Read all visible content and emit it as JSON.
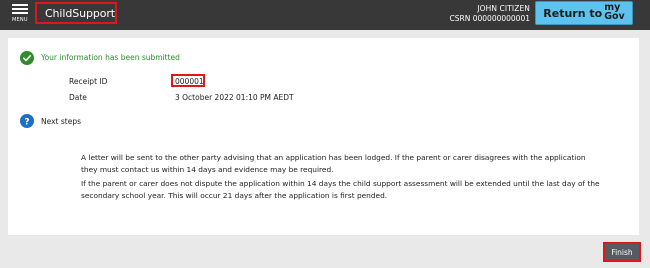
{
  "header": {
    "menu_label": "MENU",
    "brand": "ChildSupport",
    "user_name": "JOHN CITIZEN",
    "user_crn": "CSRN 000000000001",
    "return_label": "Return to",
    "mygov_my": "my",
    "mygov_gov": "Gov"
  },
  "confirmation": {
    "message": "Your information has been submitted",
    "receipt_label": "Receipt ID",
    "receipt_value": "000001",
    "date_label": "Date",
    "date_value": "3 October 2022 01:10 PM AEDT"
  },
  "next_steps": {
    "title": "Next steps",
    "paragraph_1": "A letter will be sent to the other party advising that an application has been lodged. If the parent or carer disagrees with the application they must contact us within 14 days and evidence may be required.",
    "paragraph_2": "If the parent or carer does not dispute the application within 14 days the child support assessment will be extended until the last day of the secondary school year. This will occur 21 days after the application is first pended."
  },
  "footer": {
    "finish_label": "Finish"
  },
  "colors": {
    "header_bg": "#383838",
    "accent_blue": "#5ec2ee",
    "success_green": "#2e8b2e",
    "info_blue": "#1b6fc4",
    "highlight_red": "#e0161b",
    "finish_bg": "#555b61"
  },
  "icons": {
    "menu": "hamburger-icon",
    "brand": "childsupport-logo-icon",
    "success": "check-circle-icon",
    "info": "question-circle-icon"
  }
}
